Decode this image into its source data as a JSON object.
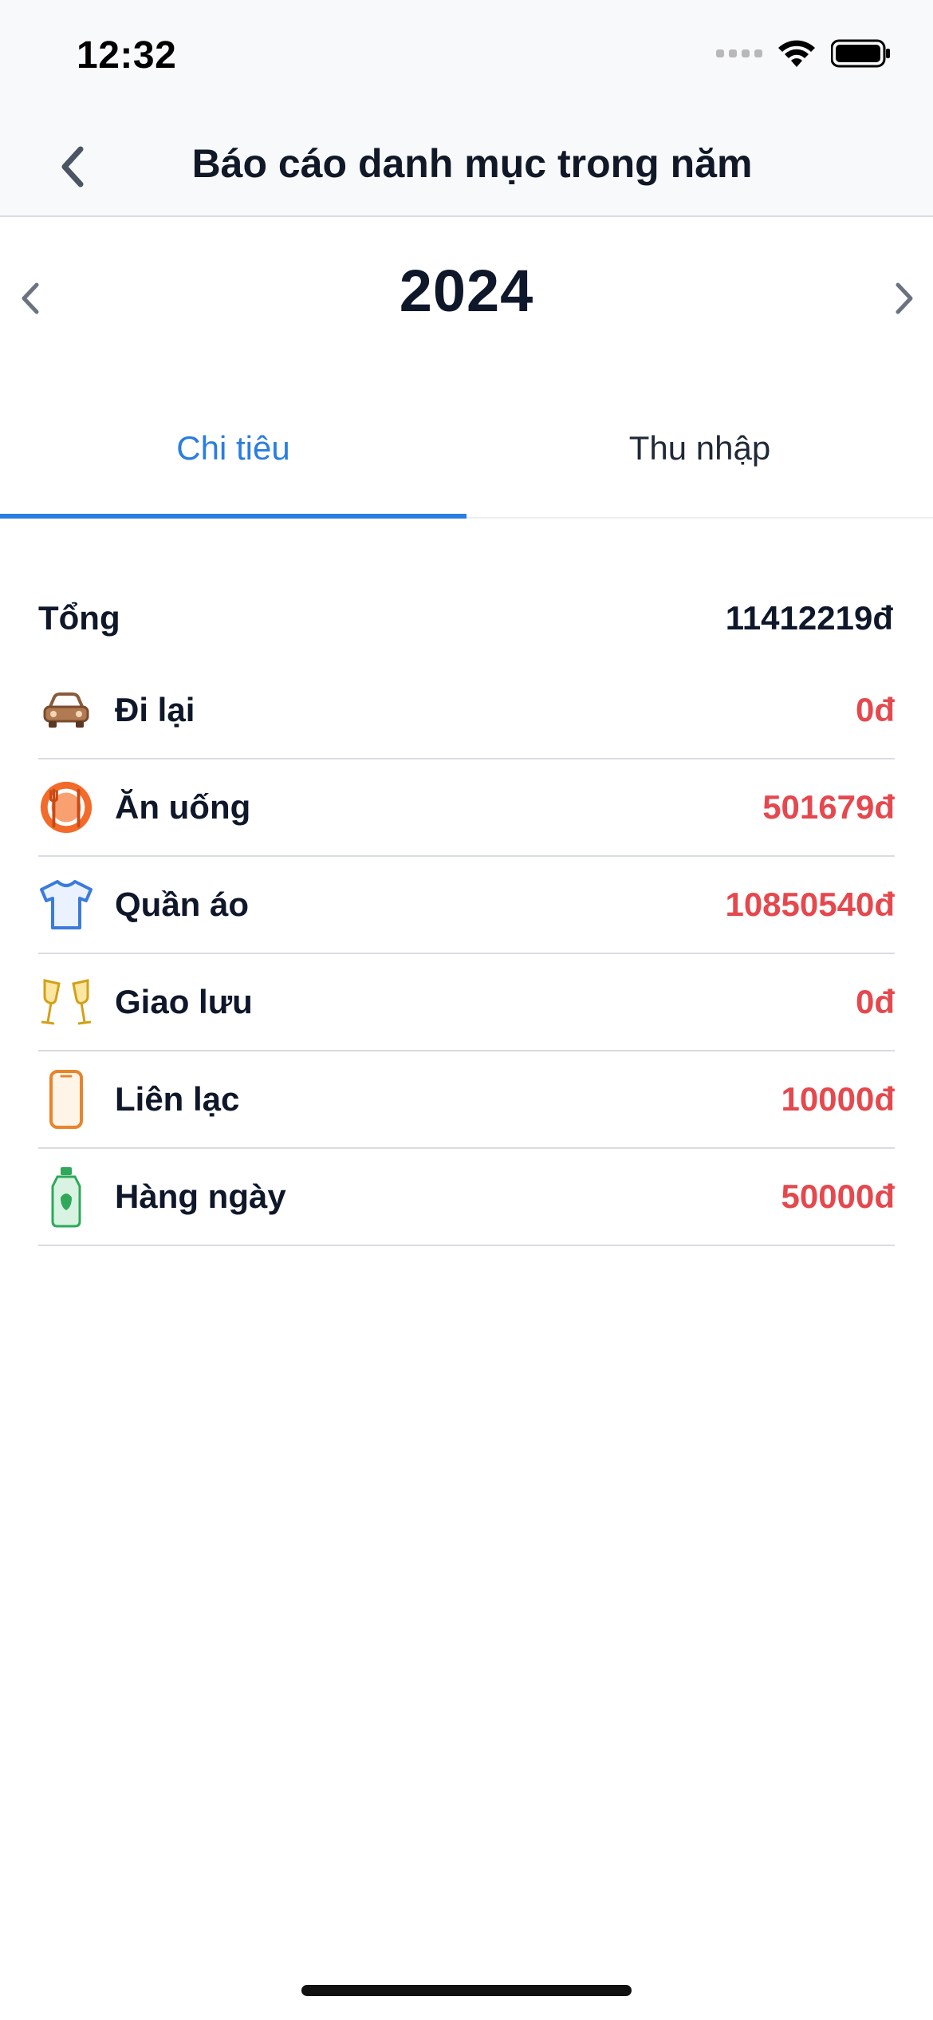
{
  "status_bar": {
    "time": "12:32",
    "signal_icon": "cellular-signal-icon",
    "wifi_icon": "wifi-icon",
    "battery_icon": "battery-icon"
  },
  "nav": {
    "title": "Báo cáo danh mục trong năm",
    "back_icon": "chevron-left-icon"
  },
  "year_selector": {
    "year": "2024",
    "prev_icon": "chevron-left-icon",
    "next_icon": "chevron-right-icon"
  },
  "tabs": [
    {
      "label": "Chi tiêu",
      "active": true
    },
    {
      "label": "Thu nhập",
      "active": false
    }
  ],
  "summary": {
    "total_label": "Tổng",
    "total_value": "11412219đ"
  },
  "categories": [
    {
      "name": "Đi lại",
      "amount": "0đ",
      "icon": "car-icon",
      "icon_color": "#8a5a3c"
    },
    {
      "name": "Ăn uống",
      "amount": "501679đ",
      "icon": "dining-plate-icon",
      "icon_color": "#f26b2a"
    },
    {
      "name": "Quần áo",
      "amount": "10850540đ",
      "icon": "tshirt-icon",
      "icon_color": "#3b7bdc"
    },
    {
      "name": "Giao lưu",
      "amount": "0đ",
      "icon": "toast-glasses-icon",
      "icon_color": "#d4a017"
    },
    {
      "name": "Liên lạc",
      "amount": "10000đ",
      "icon": "phone-icon",
      "icon_color": "#e8842a"
    },
    {
      "name": "Hàng ngày",
      "amount": "50000đ",
      "icon": "detergent-bottle-icon",
      "icon_color": "#2fa85a"
    }
  ],
  "colors": {
    "accent": "#2a7de1",
    "amount": "#e5484d",
    "text": "#0f172a"
  }
}
